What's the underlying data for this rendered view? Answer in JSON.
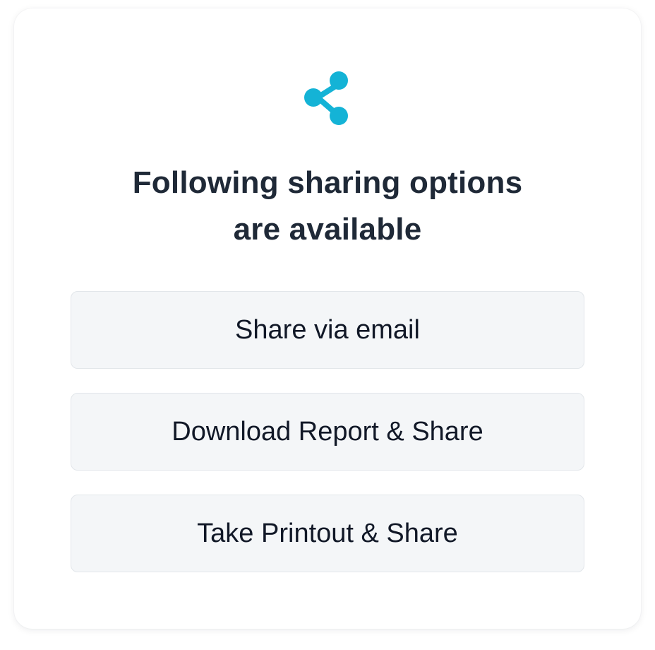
{
  "dialog": {
    "icon": "share-icon",
    "accent_color": "#14b3d6",
    "title_line1": "Following sharing options",
    "title_line2": "are available"
  },
  "options": [
    {
      "label": "Share via email"
    },
    {
      "label": "Download Report & Share"
    },
    {
      "label": "Take Printout & Share"
    }
  ]
}
